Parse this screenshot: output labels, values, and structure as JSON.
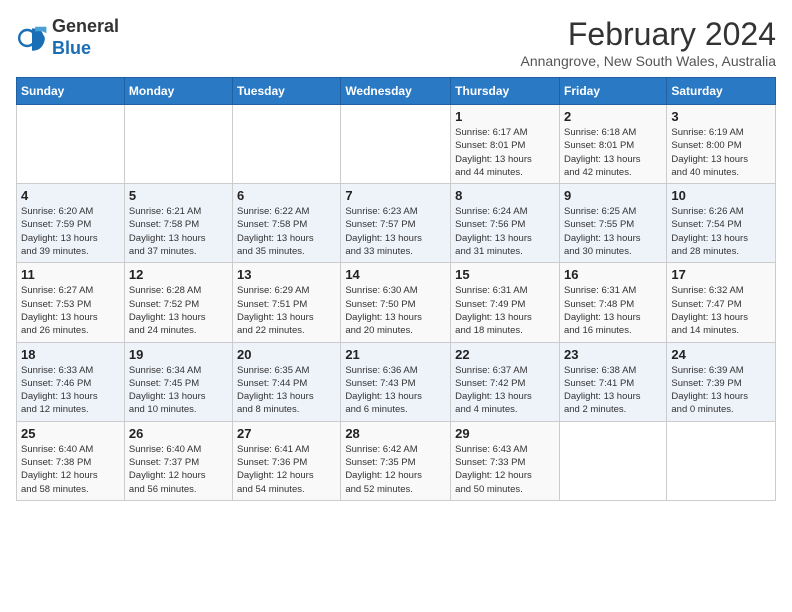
{
  "logo": {
    "general": "General",
    "blue": "Blue"
  },
  "header": {
    "month": "February 2024",
    "location": "Annangrove, New South Wales, Australia"
  },
  "weekdays": [
    "Sunday",
    "Monday",
    "Tuesday",
    "Wednesday",
    "Thursday",
    "Friday",
    "Saturday"
  ],
  "weeks": [
    [
      {
        "day": "",
        "info": ""
      },
      {
        "day": "",
        "info": ""
      },
      {
        "day": "",
        "info": ""
      },
      {
        "day": "",
        "info": ""
      },
      {
        "day": "1",
        "info": "Sunrise: 6:17 AM\nSunset: 8:01 PM\nDaylight: 13 hours\nand 44 minutes."
      },
      {
        "day": "2",
        "info": "Sunrise: 6:18 AM\nSunset: 8:01 PM\nDaylight: 13 hours\nand 42 minutes."
      },
      {
        "day": "3",
        "info": "Sunrise: 6:19 AM\nSunset: 8:00 PM\nDaylight: 13 hours\nand 40 minutes."
      }
    ],
    [
      {
        "day": "4",
        "info": "Sunrise: 6:20 AM\nSunset: 7:59 PM\nDaylight: 13 hours\nand 39 minutes."
      },
      {
        "day": "5",
        "info": "Sunrise: 6:21 AM\nSunset: 7:58 PM\nDaylight: 13 hours\nand 37 minutes."
      },
      {
        "day": "6",
        "info": "Sunrise: 6:22 AM\nSunset: 7:58 PM\nDaylight: 13 hours\nand 35 minutes."
      },
      {
        "day": "7",
        "info": "Sunrise: 6:23 AM\nSunset: 7:57 PM\nDaylight: 13 hours\nand 33 minutes."
      },
      {
        "day": "8",
        "info": "Sunrise: 6:24 AM\nSunset: 7:56 PM\nDaylight: 13 hours\nand 31 minutes."
      },
      {
        "day": "9",
        "info": "Sunrise: 6:25 AM\nSunset: 7:55 PM\nDaylight: 13 hours\nand 30 minutes."
      },
      {
        "day": "10",
        "info": "Sunrise: 6:26 AM\nSunset: 7:54 PM\nDaylight: 13 hours\nand 28 minutes."
      }
    ],
    [
      {
        "day": "11",
        "info": "Sunrise: 6:27 AM\nSunset: 7:53 PM\nDaylight: 13 hours\nand 26 minutes."
      },
      {
        "day": "12",
        "info": "Sunrise: 6:28 AM\nSunset: 7:52 PM\nDaylight: 13 hours\nand 24 minutes."
      },
      {
        "day": "13",
        "info": "Sunrise: 6:29 AM\nSunset: 7:51 PM\nDaylight: 13 hours\nand 22 minutes."
      },
      {
        "day": "14",
        "info": "Sunrise: 6:30 AM\nSunset: 7:50 PM\nDaylight: 13 hours\nand 20 minutes."
      },
      {
        "day": "15",
        "info": "Sunrise: 6:31 AM\nSunset: 7:49 PM\nDaylight: 13 hours\nand 18 minutes."
      },
      {
        "day": "16",
        "info": "Sunrise: 6:31 AM\nSunset: 7:48 PM\nDaylight: 13 hours\nand 16 minutes."
      },
      {
        "day": "17",
        "info": "Sunrise: 6:32 AM\nSunset: 7:47 PM\nDaylight: 13 hours\nand 14 minutes."
      }
    ],
    [
      {
        "day": "18",
        "info": "Sunrise: 6:33 AM\nSunset: 7:46 PM\nDaylight: 13 hours\nand 12 minutes."
      },
      {
        "day": "19",
        "info": "Sunrise: 6:34 AM\nSunset: 7:45 PM\nDaylight: 13 hours\nand 10 minutes."
      },
      {
        "day": "20",
        "info": "Sunrise: 6:35 AM\nSunset: 7:44 PM\nDaylight: 13 hours\nand 8 minutes."
      },
      {
        "day": "21",
        "info": "Sunrise: 6:36 AM\nSunset: 7:43 PM\nDaylight: 13 hours\nand 6 minutes."
      },
      {
        "day": "22",
        "info": "Sunrise: 6:37 AM\nSunset: 7:42 PM\nDaylight: 13 hours\nand 4 minutes."
      },
      {
        "day": "23",
        "info": "Sunrise: 6:38 AM\nSunset: 7:41 PM\nDaylight: 13 hours\nand 2 minutes."
      },
      {
        "day": "24",
        "info": "Sunrise: 6:39 AM\nSunset: 7:39 PM\nDaylight: 13 hours\nand 0 minutes."
      }
    ],
    [
      {
        "day": "25",
        "info": "Sunrise: 6:40 AM\nSunset: 7:38 PM\nDaylight: 12 hours\nand 58 minutes."
      },
      {
        "day": "26",
        "info": "Sunrise: 6:40 AM\nSunset: 7:37 PM\nDaylight: 12 hours\nand 56 minutes."
      },
      {
        "day": "27",
        "info": "Sunrise: 6:41 AM\nSunset: 7:36 PM\nDaylight: 12 hours\nand 54 minutes."
      },
      {
        "day": "28",
        "info": "Sunrise: 6:42 AM\nSunset: 7:35 PM\nDaylight: 12 hours\nand 52 minutes."
      },
      {
        "day": "29",
        "info": "Sunrise: 6:43 AM\nSunset: 7:33 PM\nDaylight: 12 hours\nand 50 minutes."
      },
      {
        "day": "",
        "info": ""
      },
      {
        "day": "",
        "info": ""
      }
    ]
  ]
}
